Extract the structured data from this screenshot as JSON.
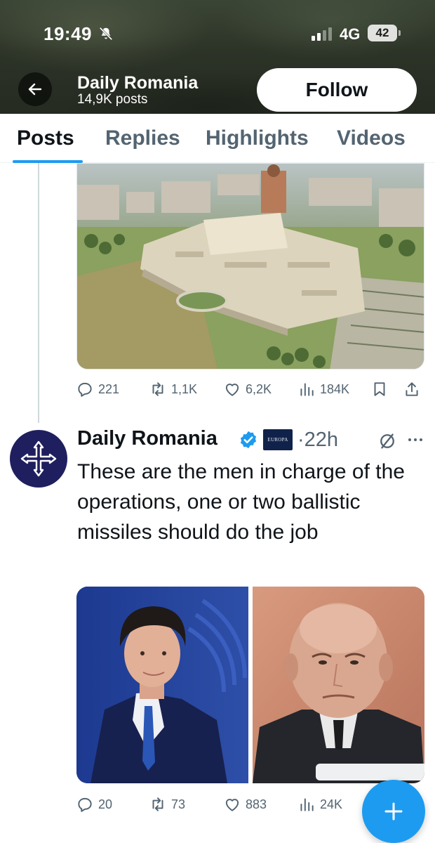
{
  "status_bar": {
    "time": "19:49",
    "network": "4G",
    "battery": "42"
  },
  "header": {
    "name": "Daily Romania",
    "posts_count": "14,9K posts",
    "follow_label": "Follow"
  },
  "tabs": [
    "Posts",
    "Replies",
    "Highlights",
    "Videos"
  ],
  "prev_post": {
    "stats": {
      "replies": "221",
      "reposts": "1,1K",
      "likes": "6,2K",
      "views": "184K"
    }
  },
  "post": {
    "author": "Daily Romania",
    "affiliation_badge": "EUROPA",
    "time": "·22h",
    "text": "These are the men in charge of the operations, one or two ballistic missiles should do the job",
    "stats": {
      "replies": "20",
      "reposts": "73",
      "likes": "883",
      "views": "24K"
    }
  },
  "colors": {
    "accent": "#1d9bf0",
    "text": "#0f1419",
    "muted": "#536471",
    "avatar_bg": "#1f1f5f"
  }
}
